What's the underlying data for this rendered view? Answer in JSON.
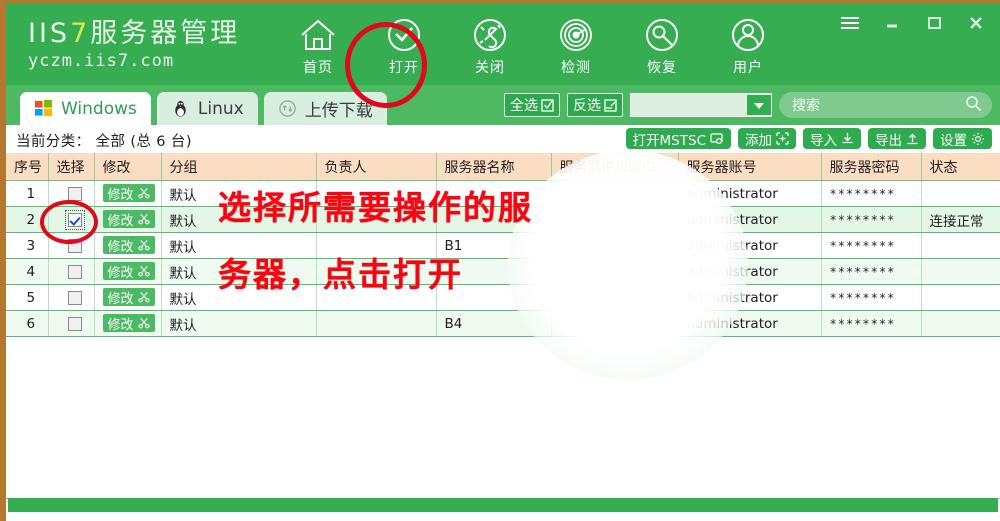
{
  "window": {
    "controls": [
      {
        "name": "menu-button",
        "icon": "hamburger-icon"
      },
      {
        "name": "minimize-button",
        "icon": "minimize-icon"
      },
      {
        "name": "maximize-button",
        "icon": "maximize-icon"
      },
      {
        "name": "close-button",
        "icon": "close-icon"
      }
    ]
  },
  "brand": {
    "title_prefix": "IIS",
    "title_highlight": "7",
    "title_suffix": "服务器管理",
    "subtitle": "yczm.iis7.com"
  },
  "toolbar": {
    "items": [
      {
        "label": "首页",
        "icon": "home-icon"
      },
      {
        "label": "打开",
        "icon": "open-check-icon"
      },
      {
        "label": "关闭",
        "icon": "close-plug-icon"
      },
      {
        "label": "检测",
        "icon": "detect-radar-icon"
      },
      {
        "label": "恢复",
        "icon": "restore-wrench-icon"
      },
      {
        "label": "用户",
        "icon": "user-icon"
      }
    ]
  },
  "tabs": [
    {
      "label": "Windows",
      "icon": "windows-logo-icon",
      "active": true
    },
    {
      "label": "Linux",
      "icon": "linux-penguin-icon",
      "active": false
    },
    {
      "label": "上传下载",
      "icon": "upload-download-icon",
      "active": false
    }
  ],
  "tabbar_controls": {
    "select_all": "全选",
    "invert_select": "反选",
    "group_filter_value": "",
    "search_placeholder": "搜索"
  },
  "category": {
    "label": "当前分类：",
    "value": "全部 (总 6 台)",
    "full": "当前分类： 全部 (总 6 台)"
  },
  "actions": [
    {
      "label": "打开MSTSC",
      "icon": "monitor-icon"
    },
    {
      "label": "添加",
      "icon": "plus-box-icon"
    },
    {
      "label": "导入",
      "icon": "download-arrow-icon"
    },
    {
      "label": "导出",
      "icon": "upload-arrow-icon"
    },
    {
      "label": "设置",
      "icon": "gear-icon"
    }
  ],
  "table": {
    "columns": [
      "序号",
      "选择",
      "修改",
      "分组",
      "负责人",
      "服务器名称",
      "服务器IP和端口",
      "服务器账号",
      "服务器密码",
      "状态"
    ],
    "modify_label": "修改",
    "rows": [
      {
        "index": "1",
        "checked": false,
        "group": "默认",
        "owner": "",
        "name": "",
        "ip": "",
        "account": "administrator",
        "password": "********",
        "status": ""
      },
      {
        "index": "2",
        "checked": true,
        "group": "默认",
        "owner": "",
        "name": "",
        "ip": "",
        "account": "administrator",
        "password": "********",
        "status": "连接正常"
      },
      {
        "index": "3",
        "checked": false,
        "group": "默认",
        "owner": "",
        "name": "B1",
        "ip": "",
        "account": "administrator",
        "password": "********",
        "status": ""
      },
      {
        "index": "4",
        "checked": false,
        "group": "默认",
        "owner": "",
        "name": "",
        "ip": "",
        "account": "administrator",
        "password": "********",
        "status": ""
      },
      {
        "index": "5",
        "checked": false,
        "group": "默认",
        "owner": "",
        "name": "",
        "ip": "",
        "account": "administrator",
        "password": "********",
        "status": ""
      },
      {
        "index": "6",
        "checked": false,
        "group": "默认",
        "owner": "",
        "name": "B4",
        "ip": "",
        "account": "administrator",
        "password": "********",
        "status": ""
      }
    ]
  },
  "annotations": {
    "note_line1": "选择所需要操作的服",
    "note_line2": "务器，点击打开",
    "highlight_open_tool": "打开",
    "highlight_row_checkbox": "2"
  },
  "colors": {
    "header_green": "#35ad50",
    "tabstrip_green": "#4eb963",
    "header_cell": "#fbdec2",
    "row_selected": "#e4f7e6",
    "annotation_red": "#f40613",
    "frame_brown": "#b5772d"
  }
}
